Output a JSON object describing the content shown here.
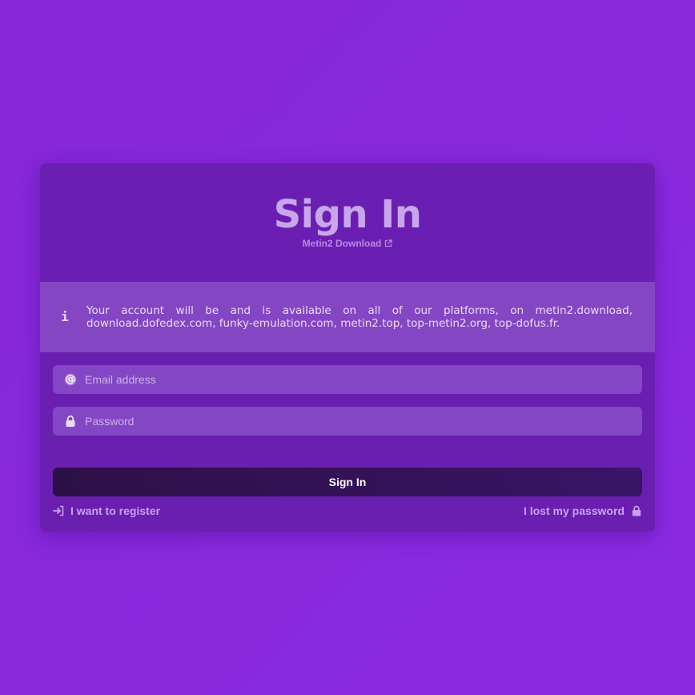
{
  "colors": {
    "background": "#8a2be2",
    "card": "#6a1fb0",
    "info_box": "#8446c3",
    "input": "#8346c4",
    "button": "#34125a",
    "link": "#c8a2ee"
  },
  "header": {
    "title": "Sign In",
    "subtitle_link": "Metin2 Download",
    "subtitle_icon": "external-link-icon"
  },
  "info": {
    "icon": "info-icon",
    "glyph": "i",
    "text": "Your account will be and is available on all of our platforms, on metin2.download, download.dofedex.com, funky-emulation.com, metin2.top, top-metin2.org, top-dofus.fr."
  },
  "form": {
    "email": {
      "icon": "at-sign-icon",
      "value": "",
      "placeholder": "Email address"
    },
    "password": {
      "icon": "lock-icon",
      "value": "",
      "placeholder": "Password"
    },
    "submit_label": "Sign In"
  },
  "links": {
    "register": {
      "label": "I want to register",
      "icon": "sign-in-arrow-icon"
    },
    "lost_password": {
      "label": "I lost my password",
      "icon": "lock-icon"
    }
  }
}
